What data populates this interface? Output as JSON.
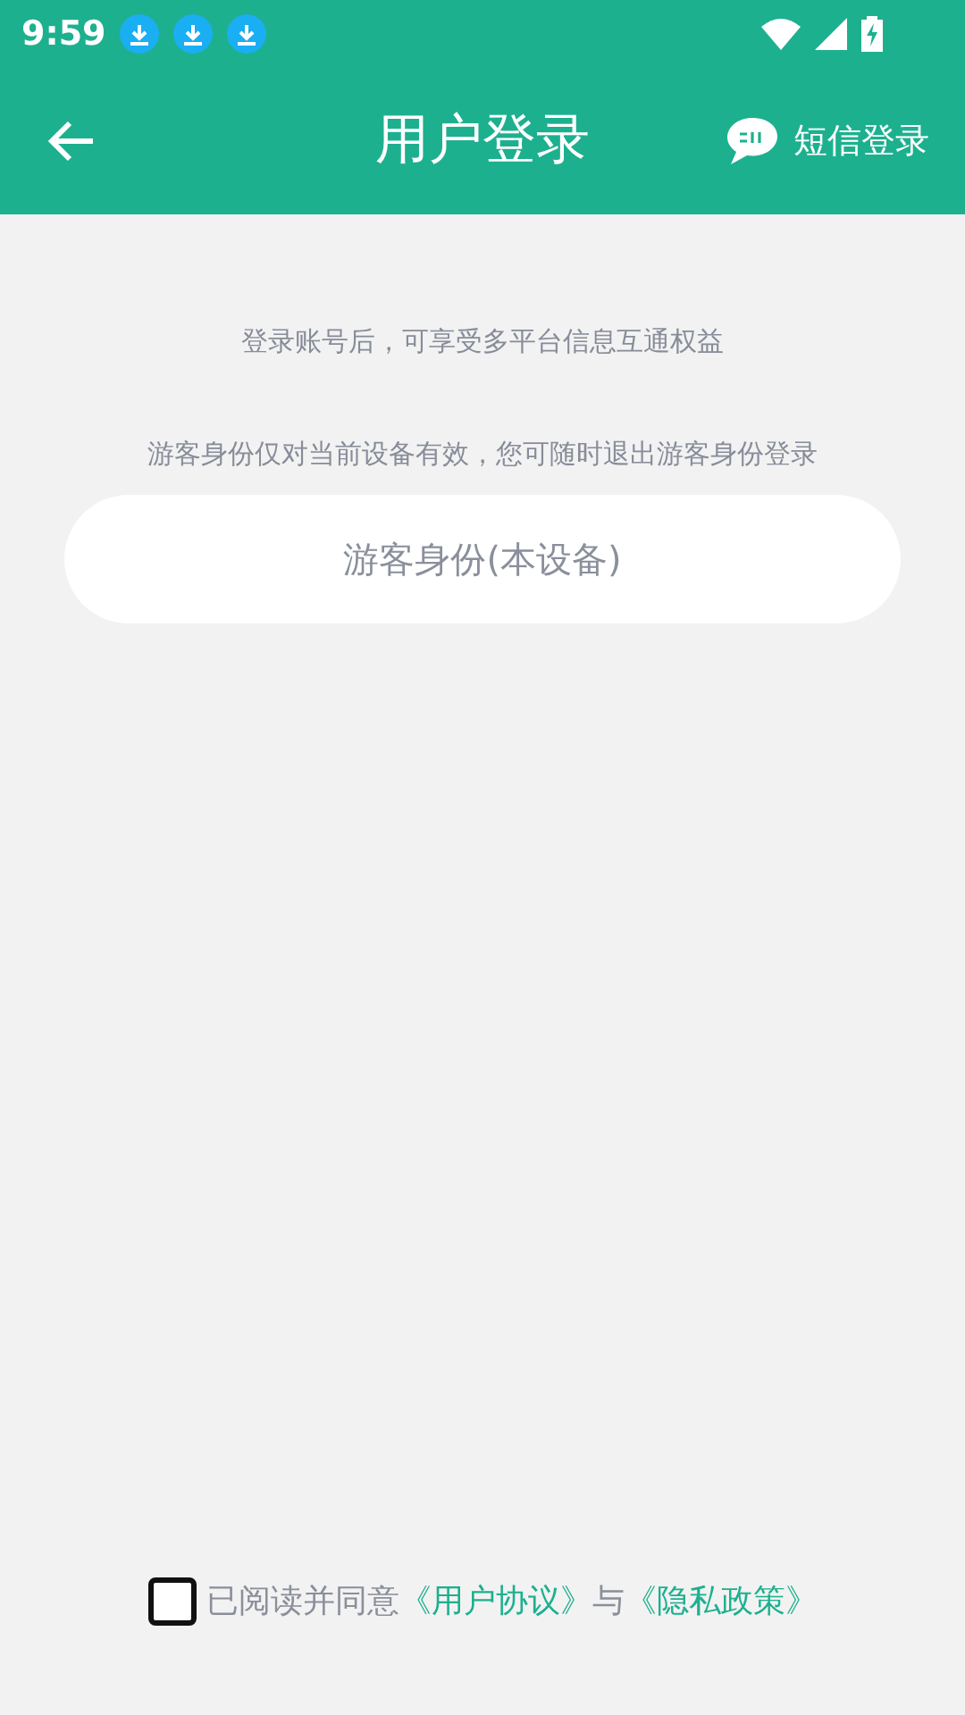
{
  "status_bar": {
    "time": "9:59",
    "notifications": [
      {
        "kind": "download"
      },
      {
        "kind": "download"
      },
      {
        "kind": "download"
      }
    ]
  },
  "app_bar": {
    "title": "用户登录",
    "action": "短信登录"
  },
  "info": [
    "登录账号后，可享受多平台信息互通权益",
    "游客身份仅对当前设备有效，您可随时退出游客身份登录"
  ],
  "guest_button": "游客身份(本设备)",
  "agreement": {
    "checked": false,
    "parts": [
      {
        "kind": "text",
        "text": "已阅读并同意"
      },
      {
        "kind": "link",
        "text": "《用户协议》"
      },
      {
        "kind": "text",
        "text": "与"
      },
      {
        "kind": "link",
        "text": "《隐私政策》"
      }
    ]
  }
}
